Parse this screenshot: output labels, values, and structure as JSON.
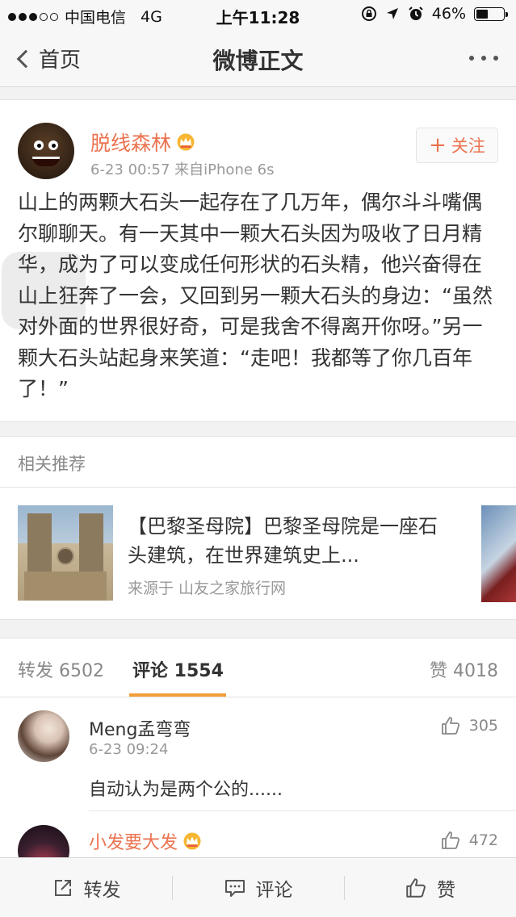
{
  "status_bar": {
    "carrier": "中国电信",
    "network": "4G",
    "time": "上午11:28",
    "battery_text": "46%",
    "battery_level": 0.46
  },
  "nav": {
    "back_label": "首页",
    "title": "微博正文"
  },
  "post": {
    "username": "脱线森林",
    "meta": "6-23 00:57  来自iPhone 6s",
    "follow_label": "关注",
    "follow_plus": "+",
    "content": "山上的两颗大石头一起存在了几万年，偶尔斗斗嘴偶尔聊聊天。有一天其中一颗大石头因为吸收了日月精华，成为了可以变成任何形状的石头精，他兴奋得在山上狂奔了一会，又回到另一颗大石头的身边：“虽然对外面的世界很好奇，可是我舍不得离开你呀。”另一颗大石头站起身来笑道：“走吧！我都等了你几百年了！”"
  },
  "related": {
    "header": "相关推荐",
    "item": {
      "title": "【巴黎圣母院】巴黎圣母院是一座石头建筑，在世界建筑史上...",
      "source": "来源于 山友之家旅行网"
    }
  },
  "tabs": {
    "repost": "转发 6502",
    "comment": "评论 1554",
    "like": "赞 4018"
  },
  "comments": [
    {
      "name": "Meng孟弯弯",
      "time": "6-23 09:24",
      "text": "自动认为是两个公的......",
      "likes": "305"
    },
    {
      "name": "小发要大发",
      "likes": "472"
    }
  ],
  "toolbar": {
    "repost": "转发",
    "comment": "评论",
    "like": "赞"
  },
  "colors": {
    "accent_orange": "#eb7350",
    "tab_underline": "#f39e3a"
  }
}
